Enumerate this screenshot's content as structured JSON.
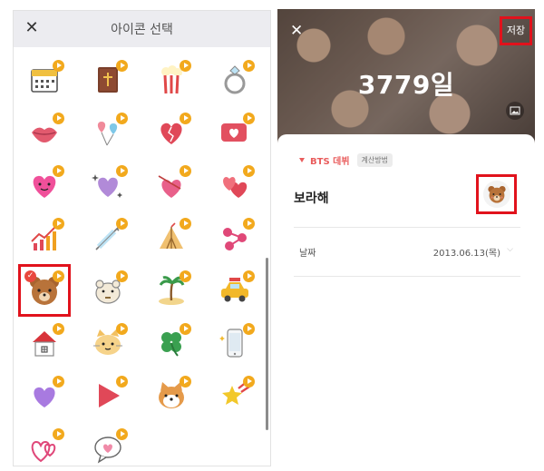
{
  "picker": {
    "title": "아이콘 선택",
    "close_symbol": "✕",
    "icons": [
      {
        "name": "calendar-icon"
      },
      {
        "name": "bible-icon"
      },
      {
        "name": "popcorn-icon"
      },
      {
        "name": "ring-icon"
      },
      {
        "name": "lips-icon"
      },
      {
        "name": "heart-balloons-icon"
      },
      {
        "name": "cracked-heart-icon"
      },
      {
        "name": "heart-message-icon"
      },
      {
        "name": "smiling-heart-icon"
      },
      {
        "name": "purple-heart-sparkle-icon"
      },
      {
        "name": "heart-arrow-box-icon"
      },
      {
        "name": "two-hearts-icon"
      },
      {
        "name": "rising-chart-icon"
      },
      {
        "name": "syringe-icon"
      },
      {
        "name": "tent-icon"
      },
      {
        "name": "connected-nodes-icon"
      },
      {
        "name": "bear-icon"
      },
      {
        "name": "hamster-icon"
      },
      {
        "name": "palm-island-icon"
      },
      {
        "name": "car-icon"
      },
      {
        "name": "house-icon"
      },
      {
        "name": "cat-icon"
      },
      {
        "name": "clover-icon"
      },
      {
        "name": "phone-icon"
      },
      {
        "name": "purple-heart-icon"
      },
      {
        "name": "play-triangle-icon"
      },
      {
        "name": "shiba-dog-icon"
      },
      {
        "name": "shooting-star-icon"
      },
      {
        "name": "outline-hearts-icon"
      },
      {
        "name": "heart-speech-bubble-icon"
      }
    ],
    "selected_icon": "bear-icon"
  },
  "editor": {
    "close_symbol": "✕",
    "save_label": "저장",
    "day_count": "3779일",
    "category_label": "BTS 데뷔",
    "calc_method_label": "계산방법",
    "name_value": "보라해",
    "date_label": "날짜",
    "date_value": "2013.06.13(목)",
    "date_chevron": "⌵"
  },
  "colors": {
    "accent_red": "#e1121c",
    "badge_orange": "#f2a91d",
    "category_red": "#e95c5c"
  }
}
